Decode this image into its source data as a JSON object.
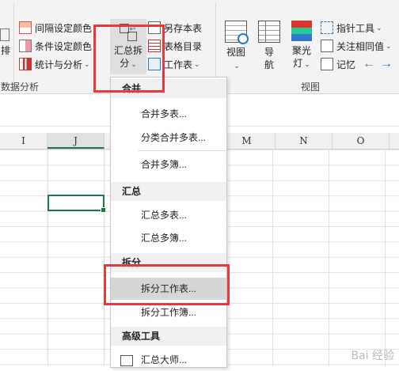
{
  "colors": {
    "accent": "#217346",
    "highlight_box": "#e8383b",
    "menu_highlight": "#d6d6d6"
  },
  "ribbon": {
    "left_partial": {
      "line1": "排"
    },
    "data_analysis": {
      "items": [
        {
          "label": "间隔设定颜色",
          "icon": "grid-color-icon"
        },
        {
          "label": "条件设定颜色",
          "icon": "conditional-color-icon"
        },
        {
          "label": "统计与分析",
          "icon": "statistics-icon"
        }
      ],
      "group_label": "数据分析"
    },
    "summarize_split": {
      "line1": "汇总拆",
      "line2": "分"
    },
    "save_items": [
      {
        "label": "另存本表",
        "icon": "save-sheet-icon"
      },
      {
        "label": "表格目录",
        "icon": "table-directory-icon"
      },
      {
        "label": "工作表",
        "icon": "worksheet-icon"
      }
    ],
    "view_group": {
      "view": {
        "line1": "视图",
        "line2": ""
      },
      "nav": {
        "line1": "导",
        "line2": "航"
      },
      "spotlight": {
        "line1": "聚光",
        "line2": "灯"
      },
      "small": [
        {
          "label": "指针工具",
          "icon": "pointer-tool-icon"
        },
        {
          "label": "关注相同值",
          "icon": "same-value-icon"
        },
        {
          "label": "记忆",
          "icon": "memory-icon"
        }
      ],
      "group_label": "视图"
    }
  },
  "columns": [
    "I",
    "J",
    "M",
    "N",
    "O"
  ],
  "menu": {
    "sections": [
      {
        "header": "合并",
        "items": [
          "合并多表...",
          "分类合并多表...",
          "合并多簿..."
        ]
      },
      {
        "header": "汇总",
        "items": [
          "汇总多表...",
          "汇总多簿..."
        ]
      },
      {
        "header": "拆分",
        "items": [
          "拆分工作表...",
          "拆分工作簿..."
        ]
      },
      {
        "header": "高级工具",
        "items": [
          "汇总大师..."
        ]
      }
    ]
  },
  "watermark": "Bai 经验"
}
